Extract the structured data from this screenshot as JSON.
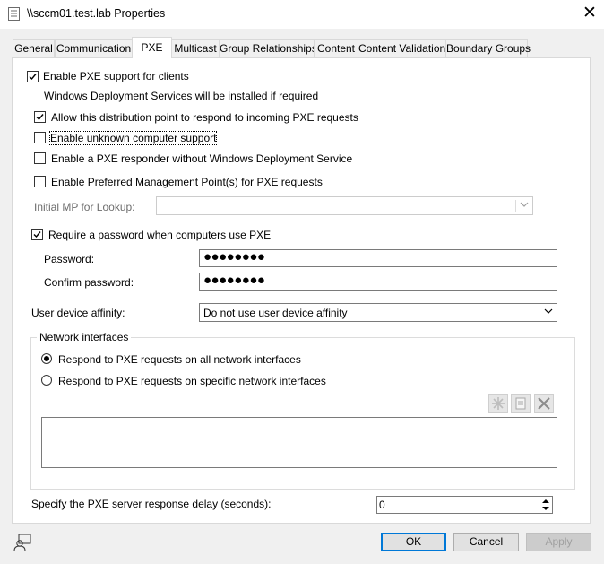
{
  "window": {
    "title": "\\\\sccm01.test.lab Properties",
    "close_glyph": "✕"
  },
  "tabs": [
    {
      "label": "General"
    },
    {
      "label": "Communication"
    },
    {
      "label": "PXE",
      "active": true
    },
    {
      "label": "Multicast"
    },
    {
      "label": "Group Relationships"
    },
    {
      "label": "Content"
    },
    {
      "label": "Content Validation"
    },
    {
      "label": "Boundary Groups"
    }
  ],
  "pxe": {
    "enable_pxe": {
      "label": "Enable PXE support for clients",
      "checked": true
    },
    "wds_note": "Windows Deployment Services will be installed if required",
    "allow_respond": {
      "label": "Allow this distribution point to respond to incoming PXE requests",
      "checked": true
    },
    "unknown_support": {
      "label": "Enable unknown computer support",
      "checked": false
    },
    "responder_without_wds": {
      "label": "Enable a PXE responder without Windows Deployment Service",
      "checked": false
    },
    "preferred_mp": {
      "label": "Enable Preferred Management Point(s) for PXE requests",
      "checked": false
    },
    "initial_mp_label": "Initial MP for Lookup:",
    "initial_mp_value": "",
    "require_password": {
      "label": "Require a password when computers use PXE",
      "checked": true
    },
    "password_label": "Password:",
    "password_value": "●●●●●●●●",
    "confirm_label": "Confirm password:",
    "confirm_value": "●●●●●●●●",
    "affinity_label": "User device affinity:",
    "affinity_value": "Do not use user device affinity",
    "network_group_label": "Network interfaces",
    "radio_all": {
      "label": "Respond to PXE requests on all network interfaces",
      "selected": true
    },
    "radio_specific": {
      "label": "Respond to PXE requests on specific network interfaces",
      "selected": false
    },
    "delay_label": "Specify the PXE server response delay (seconds):",
    "delay_value": "0"
  },
  "buttons": {
    "ok": "OK",
    "cancel": "Cancel",
    "apply": "Apply"
  },
  "icons": {
    "title": "properties-icon",
    "help": "user-help-icon",
    "toolbar": [
      "star-icon",
      "properties-icon",
      "delete-icon"
    ]
  }
}
